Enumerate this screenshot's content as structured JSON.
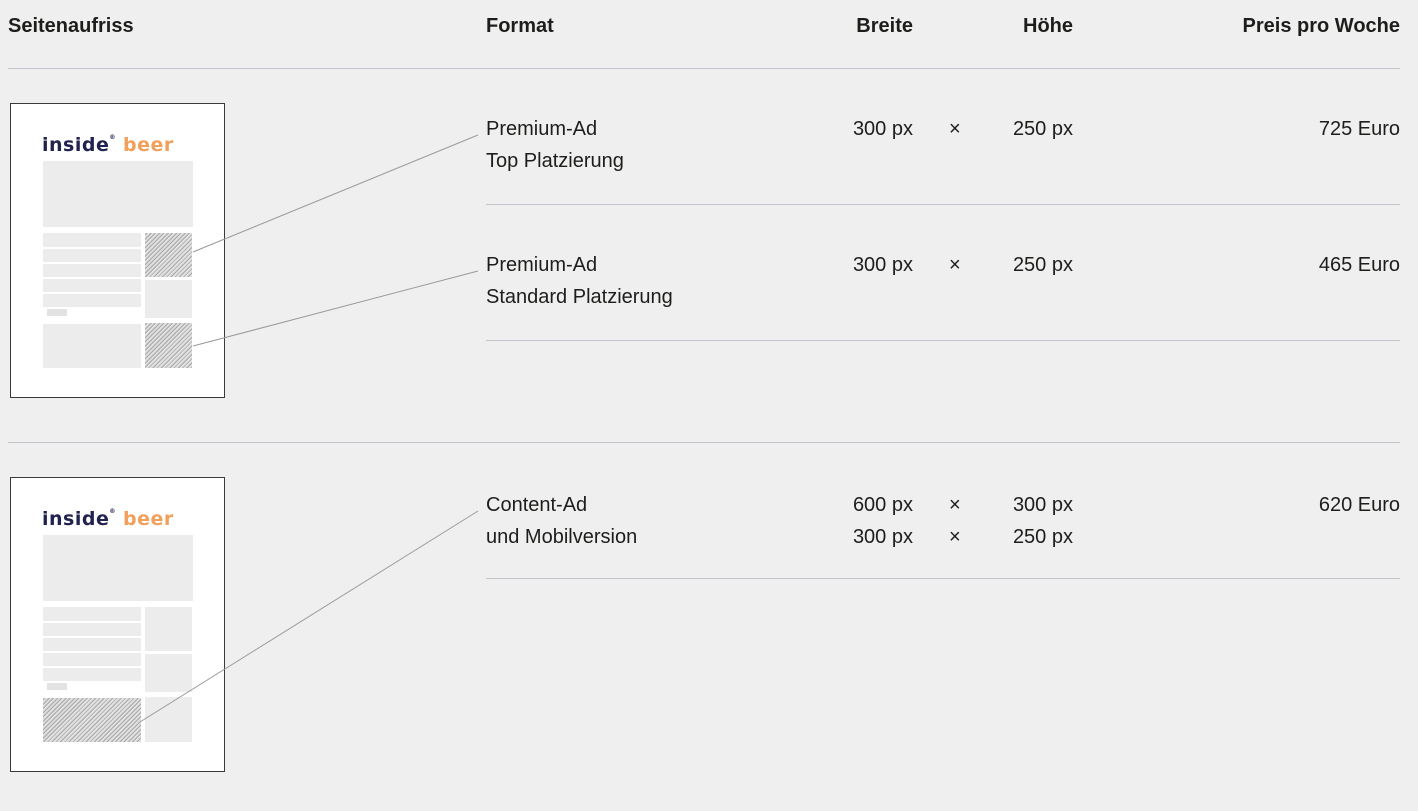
{
  "header": {
    "seitenaufriss": "Seitenaufriss",
    "format": "Format",
    "breite": "Breite",
    "hoehe": "Höhe",
    "preis": "Preis pro Woche"
  },
  "logo": {
    "part1": "inside",
    "part2": "beer",
    "colors": {
      "inside": "#222250",
      "beer": "#f0a05a"
    }
  },
  "times_symbol": "×",
  "rows": [
    {
      "format_line1": "Premium-Ad",
      "format_line2": "Top Platzierung",
      "width": "300 px",
      "height": "250 px",
      "price": "725 Euro"
    },
    {
      "format_line1": "Premium-Ad",
      "format_line2": "Standard Platzierung",
      "width": "300 px",
      "height": "250 px",
      "price": "465 Euro"
    },
    {
      "format_line1": "Content-Ad",
      "format_line2": "und Mobilversion",
      "width": "600 px",
      "height": "300 px",
      "width2": "300 px",
      "height2": "250 px",
      "price": "620 Euro"
    }
  ]
}
